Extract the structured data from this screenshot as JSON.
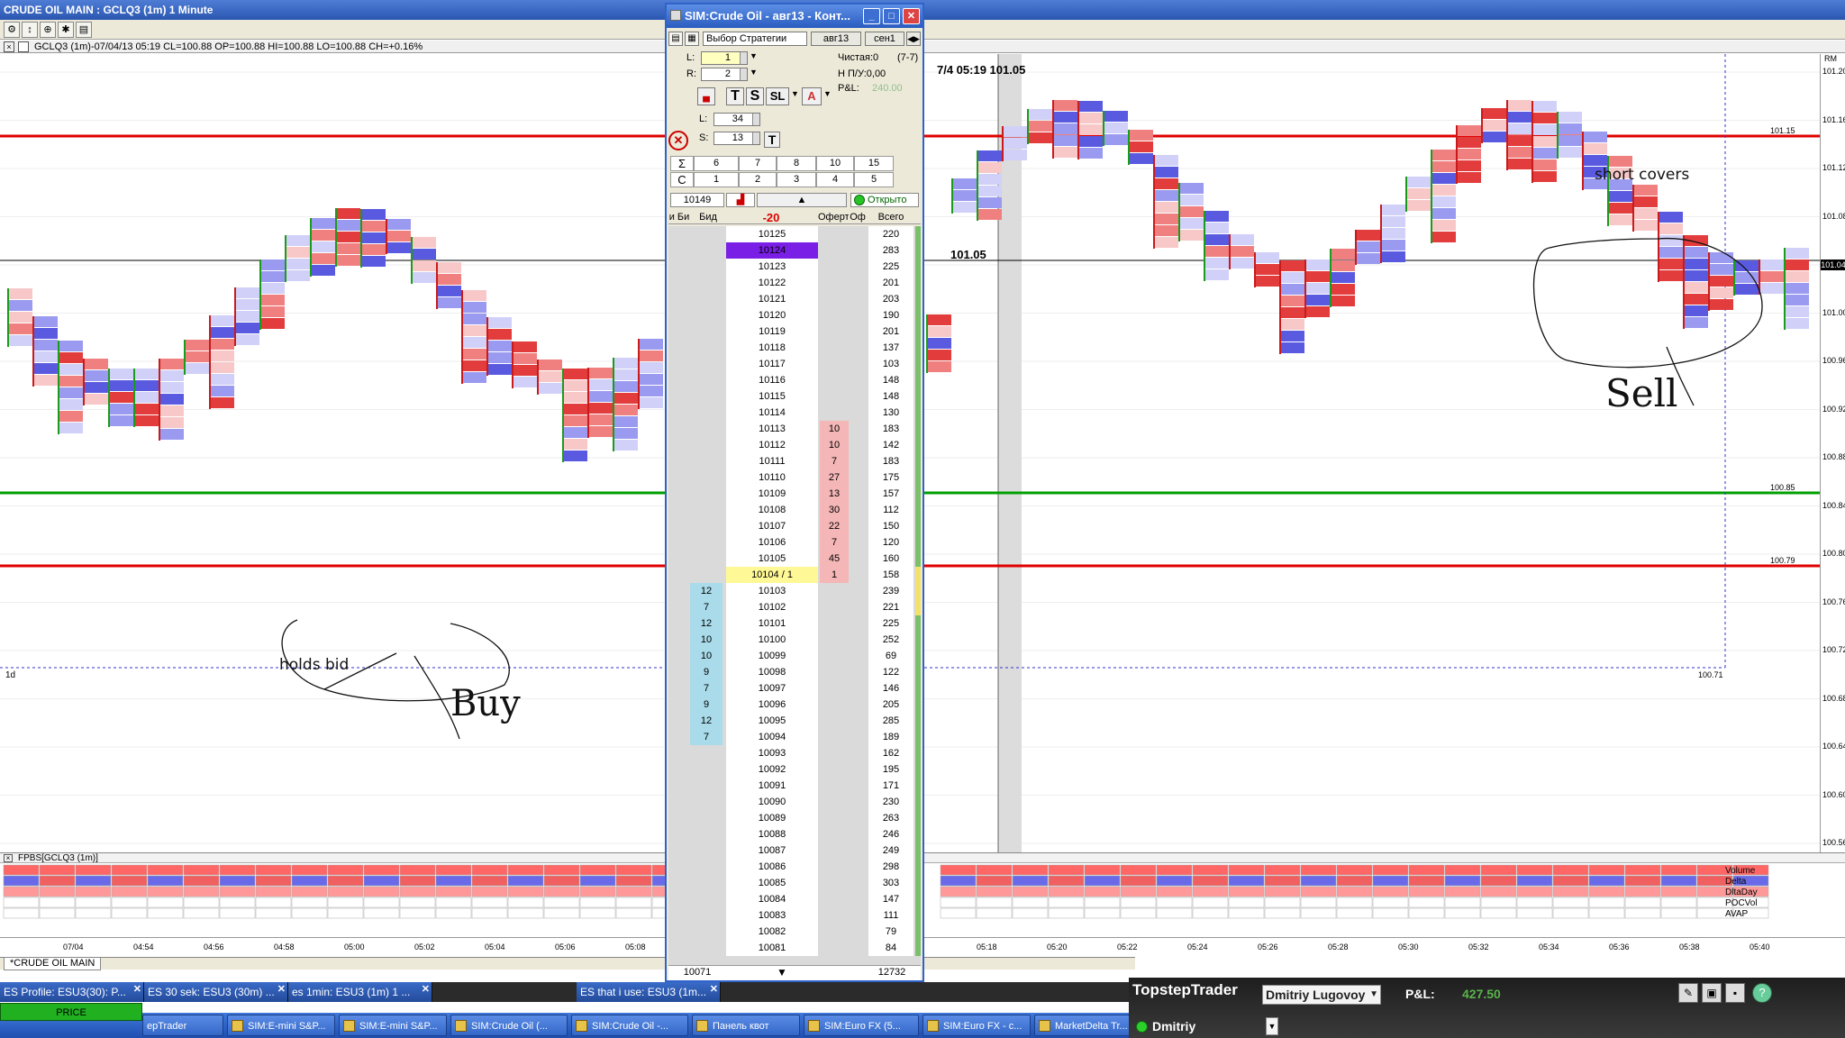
{
  "main_window": {
    "title": "CRUDE OIL MAIN : GCLQ3 (1m) 1 Minute"
  },
  "chart_header": {
    "info": "GCLQ3 (1m)-07/04/13 05:19 CL=100.88 OP=100.88 HI=100.88 LO=100.88 CH=+0.16%"
  },
  "chart": {
    "crosshair_label": "7/4 05:19 101.05",
    "line_label": "101.05",
    "level_labels": {
      "red_top": "101.15",
      "green": "100.85",
      "red_mid": "100.79",
      "dotted": "100.71"
    },
    "price_labels": [
      "101.20",
      "101.16",
      "101.12",
      "101.08",
      "101.04",
      "101.00",
      "100.96",
      "100.92",
      "100.88",
      "100.84",
      "100.80",
      "100.76",
      "100.72",
      "100.68",
      "100.64",
      "100.60",
      "100.56"
    ],
    "current_price": "101.04",
    "axis_corner": "RM",
    "left_marker": "1d",
    "bottom_panel_header": "FPBS[GCLQ3 (1m)]",
    "row_names": [
      "Volume",
      "Delta",
      "DltaDay",
      "POCVol",
      "AVAP"
    ],
    "time_labels": [
      "07/04",
      "04:54",
      "04:56",
      "04:58",
      "05:00",
      "05:02",
      "05:04",
      "05:06",
      "05:08",
      "05:18",
      "05:20",
      "05:22",
      "05:24",
      "05:26",
      "05:28",
      "05:30",
      "05:32",
      "05:34",
      "05:36",
      "05:38",
      "05:40"
    ],
    "annotations": {
      "holds_bid": "holds bid",
      "buy": "Buy",
      "short_covers": "short covers",
      "sell": "Sell"
    }
  },
  "bottom_tab": "*CRUDE OIL MAIN",
  "dom": {
    "title": "SIM:Crude Oil - авг13 - Конт...",
    "strategy_label": "Выбор Стратегии",
    "contract": "авг13",
    "contract2": "сен1",
    "l_label": "L:",
    "l_value": "1",
    "r_label": "R:",
    "r_value": "2",
    "net_label": "Чистая:0",
    "net_extra": "(7-7)",
    "pl_label": "Н П/У:0,00",
    "pnl_label": "P&L:",
    "pnl_value": "240.00",
    "l2_label": "L:",
    "l2_value": "34",
    "s_label": "S:",
    "s_value": "13",
    "grid_row1": [
      "Σ",
      "6",
      "7",
      "8",
      "10",
      "15"
    ],
    "grid_row2": [
      "C",
      "1",
      "2",
      "3",
      "4",
      "5"
    ],
    "account_value": "10149",
    "status_open": "Открыто",
    "col_bid_ask": "и Би",
    "col_bid": "Бид",
    "col_delta": "-20",
    "col_offer": "Оферт",
    "col_of": "Оф",
    "col_total": "Всего",
    "footer_left": "10071",
    "footer_right": "12732",
    "ladder": [
      {
        "p": "10125",
        "a": "",
        "b": "",
        "t": "220"
      },
      {
        "p": "10124",
        "a": "",
        "b": "",
        "t": "283",
        "hl": "purple"
      },
      {
        "p": "10123",
        "a": "",
        "b": "",
        "t": "225"
      },
      {
        "p": "10122",
        "a": "",
        "b": "",
        "t": "201"
      },
      {
        "p": "10121",
        "a": "",
        "b": "",
        "t": "203"
      },
      {
        "p": "10120",
        "a": "",
        "b": "",
        "t": "190"
      },
      {
        "p": "10119",
        "a": "",
        "b": "",
        "t": "201"
      },
      {
        "p": "10118",
        "a": "",
        "b": "",
        "t": "137"
      },
      {
        "p": "10117",
        "a": "",
        "b": "",
        "t": "103"
      },
      {
        "p": "10116",
        "a": "",
        "b": "",
        "t": "148"
      },
      {
        "p": "10115",
        "a": "",
        "b": "",
        "t": "148"
      },
      {
        "p": "10114",
        "a": "",
        "b": "",
        "t": "130"
      },
      {
        "p": "10113",
        "a": "10",
        "b": "",
        "t": "183"
      },
      {
        "p": "10112",
        "a": "10",
        "b": "",
        "t": "142"
      },
      {
        "p": "10111",
        "a": "7",
        "b": "",
        "t": "183"
      },
      {
        "p": "10110",
        "a": "27",
        "b": "",
        "t": "175"
      },
      {
        "p": "10109",
        "a": "13",
        "b": "",
        "t": "157"
      },
      {
        "p": "10108",
        "a": "30",
        "b": "",
        "t": "112"
      },
      {
        "p": "10107",
        "a": "22",
        "b": "",
        "t": "150"
      },
      {
        "p": "10106",
        "a": "7",
        "b": "",
        "t": "120"
      },
      {
        "p": "10105",
        "a": "45",
        "b": "",
        "t": "160"
      },
      {
        "p": "10104 / 1",
        "a": "1",
        "b": "",
        "t": "158",
        "hl": "yellow"
      },
      {
        "p": "10103",
        "a": "",
        "b": "12",
        "t": "239"
      },
      {
        "p": "10102",
        "a": "",
        "b": "7",
        "t": "221"
      },
      {
        "p": "10101",
        "a": "",
        "b": "12",
        "t": "225"
      },
      {
        "p": "10100",
        "a": "",
        "b": "10",
        "t": "252"
      },
      {
        "p": "10099",
        "a": "",
        "b": "10",
        "t": "69"
      },
      {
        "p": "10098",
        "a": "",
        "b": "9",
        "t": "122"
      },
      {
        "p": "10097",
        "a": "",
        "b": "7",
        "t": "146"
      },
      {
        "p": "10096",
        "a": "",
        "b": "9",
        "t": "205"
      },
      {
        "p": "10095",
        "a": "",
        "b": "12",
        "t": "285"
      },
      {
        "p": "10094",
        "a": "",
        "b": "7",
        "t": "189"
      },
      {
        "p": "10093",
        "a": "",
        "b": "",
        "t": "162"
      },
      {
        "p": "10092",
        "a": "",
        "b": "",
        "t": "195"
      },
      {
        "p": "10091",
        "a": "",
        "b": "",
        "t": "171"
      },
      {
        "p": "10090",
        "a": "",
        "b": "",
        "t": "230"
      },
      {
        "p": "10089",
        "a": "",
        "b": "",
        "t": "263"
      },
      {
        "p": "10088",
        "a": "",
        "b": "",
        "t": "246"
      },
      {
        "p": "10087",
        "a": "",
        "b": "",
        "t": "249"
      },
      {
        "p": "10086",
        "a": "",
        "b": "",
        "t": "298"
      },
      {
        "p": "10085",
        "a": "",
        "b": "",
        "t": "303"
      },
      {
        "p": "10084",
        "a": "",
        "b": "",
        "t": "147"
      },
      {
        "p": "10083",
        "a": "",
        "b": "",
        "t": "111"
      },
      {
        "p": "10082",
        "a": "",
        "b": "",
        "t": "79"
      },
      {
        "p": "10081",
        "a": "",
        "b": "",
        "t": "84"
      }
    ]
  },
  "workspace_tabs": [
    {
      "label": "ES Profile: ESU3(30): P..."
    },
    {
      "label": "ES 30 sek: ESU3 (30m) ..."
    },
    {
      "label": "es 1min: ESU3 (1m) 1 ..."
    },
    {
      "label": "ES that i use: ESU3 (1m..."
    }
  ],
  "price_button": "PRICE",
  "taskbar": [
    {
      "label": "epTrader"
    },
    {
      "label": "SIM:E-mini S&P..."
    },
    {
      "label": "SIM:E-mini S&P..."
    },
    {
      "label": "SIM:Crude Oil (..."
    },
    {
      "label": "SIM:Crude Oil -..."
    },
    {
      "label": "Панель квот"
    },
    {
      "label": "SIM:Euro FX (5..."
    },
    {
      "label": "SIM:Euro FX - c..."
    },
    {
      "label": "MarketDelta Tr..."
    }
  ],
  "topstep": {
    "brand": "TopstepTrader",
    "user": "Dmitriy Lugovoy",
    "pl_label": "P&L:",
    "pl_value": "427.50",
    "status": "Dmitriy"
  },
  "colors": {
    "red_level": "#e00000",
    "green_level": "#00a000",
    "bid": "#6d6df0",
    "ask": "#e84040",
    "taskbar": "#2a5fc9"
  }
}
